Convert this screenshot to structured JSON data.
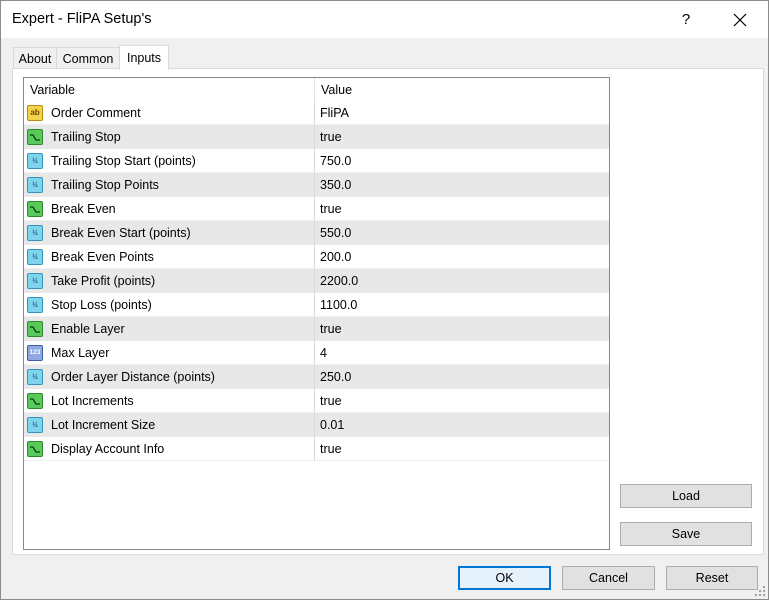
{
  "window": {
    "title": "Expert - FliPA Setup's",
    "help_label": "?",
    "close_icon": "close-icon"
  },
  "tabs": [
    {
      "label": "About",
      "active": false
    },
    {
      "label": "Common",
      "active": false
    },
    {
      "label": "Inputs",
      "active": true
    }
  ],
  "table": {
    "columns": {
      "variable": "Variable",
      "value": "Value"
    },
    "rows": [
      {
        "icon": "string",
        "name": "Order Comment",
        "value": "FliPA"
      },
      {
        "icon": "bool",
        "name": "Trailing Stop",
        "value": "true"
      },
      {
        "icon": "double",
        "name": "Trailing Stop Start (points)",
        "value": "750.0"
      },
      {
        "icon": "double",
        "name": "Trailing Stop Points",
        "value": "350.0"
      },
      {
        "icon": "bool",
        "name": "Break Even",
        "value": "true"
      },
      {
        "icon": "double",
        "name": "Break Even Start (points)",
        "value": "550.0"
      },
      {
        "icon": "double",
        "name": "Break Even Points",
        "value": "200.0"
      },
      {
        "icon": "double",
        "name": "Take Profit (points)",
        "value": "2200.0"
      },
      {
        "icon": "double",
        "name": "Stop Loss (points)",
        "value": "1100.0"
      },
      {
        "icon": "bool",
        "name": "Enable Layer",
        "value": "true"
      },
      {
        "icon": "int",
        "name": "Max Layer",
        "value": "4"
      },
      {
        "icon": "double",
        "name": "Order Layer Distance (points)",
        "value": "250.0"
      },
      {
        "icon": "bool",
        "name": "Lot Increments",
        "value": "true"
      },
      {
        "icon": "double",
        "name": "Lot Increment Size",
        "value": "0.01"
      },
      {
        "icon": "bool",
        "name": "Display Account Info",
        "value": "true"
      }
    ]
  },
  "side_buttons": {
    "load": "Load",
    "save": "Save"
  },
  "footer_buttons": {
    "ok": "OK",
    "cancel": "Cancel",
    "reset": "Reset"
  },
  "icon_glyphs": {
    "string": "ab",
    "double": "½",
    "int": "123"
  }
}
